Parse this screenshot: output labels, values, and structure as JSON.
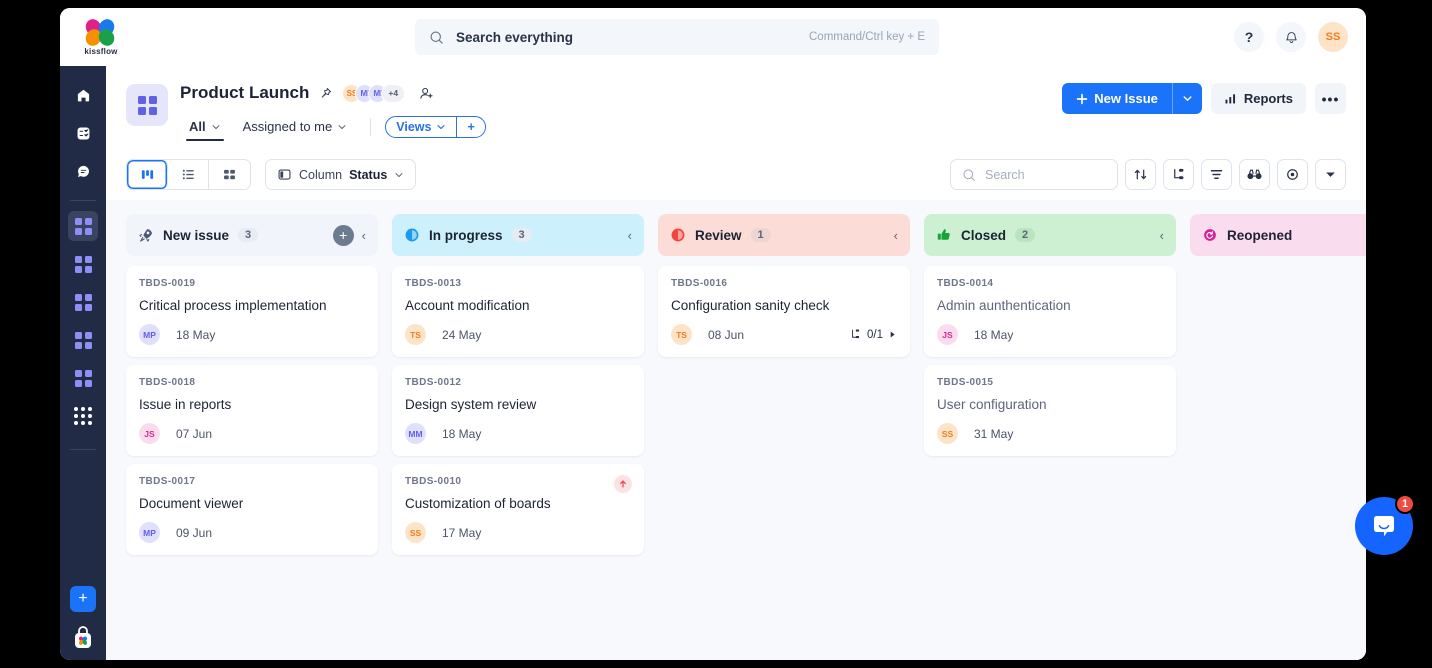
{
  "brand": {
    "name": "kissflow"
  },
  "search": {
    "placeholder": "Search everything",
    "hint": "Command/Ctrl key + E"
  },
  "topbar": {
    "help_label": "?",
    "avatar_initials": "SS"
  },
  "project": {
    "title": "Product Launch",
    "members": [
      {
        "initials": "SS",
        "bg": "#fde3c8",
        "color": "#f07d1a"
      },
      {
        "initials": "MI",
        "bg": "#e0e0fb",
        "color": "#6161e8"
      },
      {
        "initials": "MI",
        "bg": "#e0e0fb",
        "color": "#6161e8"
      }
    ],
    "members_more": "+4",
    "tabs": [
      {
        "label": "All",
        "active": true
      },
      {
        "label": "Assigned to me",
        "active": false
      }
    ],
    "views_label": "Views",
    "views_add_label": "+"
  },
  "actions": {
    "new_issue_label": "New Issue",
    "reports_label": "Reports",
    "more_label": "•••"
  },
  "toolbar": {
    "views": [
      "board-view",
      "list-view",
      "grid-view"
    ],
    "column_label": "Column",
    "column_value": "Status",
    "search_placeholder": "Search",
    "icons": [
      "sort-icon",
      "group-icon",
      "filter-icon",
      "watch-icon",
      "visibility-icon",
      "chevron-down-icon"
    ]
  },
  "board": {
    "columns": [
      {
        "name": "New issue",
        "count": "3",
        "icon": "rocket-icon",
        "header_bg": "#f1f4fa",
        "has_add": true,
        "cards": [
          {
            "id": "TBDS-0019",
            "title": "Critical process implementation",
            "avatar": "MP",
            "av_bg": "#e0e0fb",
            "av_color": "#6161e8",
            "date": "18 May",
            "subtasks": "",
            "priority": false
          },
          {
            "id": "TBDS-0018",
            "title": "Issue in reports",
            "avatar": "JS",
            "av_bg": "#fbdcee",
            "av_color": "#d6288f",
            "date": "07 Jun",
            "subtasks": "",
            "priority": false
          },
          {
            "id": "TBDS-0017",
            "title": "Document viewer",
            "avatar": "MP",
            "av_bg": "#e0e0fb",
            "av_color": "#6161e8",
            "date": "09 Jun",
            "subtasks": "",
            "priority": false
          }
        ]
      },
      {
        "name": "In progress",
        "count": "3",
        "icon": "progress-icon",
        "header_bg": "#cdf0fd",
        "has_add": false,
        "cards": [
          {
            "id": "TBDS-0013",
            "title": "Account modification",
            "avatar": "TS",
            "av_bg": "#fde3c8",
            "av_color": "#f07d1a",
            "date": "24 May",
            "subtasks": "",
            "priority": false
          },
          {
            "id": "TBDS-0012",
            "title": "Design system review",
            "avatar": "MM",
            "av_bg": "#e0e0fb",
            "av_color": "#6161e8",
            "date": "18 May",
            "subtasks": "",
            "priority": false
          },
          {
            "id": "TBDS-0010",
            "title": "Customization of boards",
            "avatar": "SS",
            "av_bg": "#fde3c8",
            "av_color": "#f07d1a",
            "date": "17 May",
            "subtasks": "",
            "priority": true
          }
        ]
      },
      {
        "name": "Review",
        "count": "1",
        "icon": "review-icon",
        "header_bg": "#fcdcd6",
        "has_add": false,
        "cards": [
          {
            "id": "TBDS-0016",
            "title": "Configuration sanity check",
            "avatar": "TS",
            "av_bg": "#fde3c8",
            "av_color": "#f07d1a",
            "date": "08 Jun",
            "subtasks": "0/1",
            "priority": false
          }
        ]
      },
      {
        "name": "Closed",
        "count": "2",
        "icon": "thumbs-up-icon",
        "header_bg": "#cdf0d2",
        "has_add": false,
        "cards": [
          {
            "id": "TBDS-0014",
            "title": "Admin aunthentication",
            "avatar": "JS",
            "av_bg": "#fbdcee",
            "av_color": "#d6288f",
            "date": "18 May",
            "subtasks": "",
            "priority": false
          },
          {
            "id": "TBDS-0015",
            "title": "User configuration",
            "avatar": "SS",
            "av_bg": "#fde3c8",
            "av_color": "#f07d1a",
            "date": "31 May",
            "subtasks": "",
            "priority": false
          }
        ]
      },
      {
        "name": "Reopened",
        "count": "",
        "icon": "reopen-icon",
        "header_bg": "#fadcef",
        "has_add": false,
        "cards": []
      }
    ]
  },
  "sidebar": {
    "items": [
      {
        "name": "home-icon"
      },
      {
        "name": "tasks-icon"
      },
      {
        "name": "chat-icon"
      },
      {
        "name": "board-app-1",
        "active": true
      },
      {
        "name": "board-app-2",
        "active": false
      },
      {
        "name": "board-app-3",
        "active": false
      },
      {
        "name": "board-app-4",
        "active": false
      },
      {
        "name": "board-app-5",
        "active": false
      },
      {
        "name": "apps-grid-icon",
        "active": false
      }
    ],
    "add_label": "+"
  },
  "intercom": {
    "badge": "1"
  },
  "colors": {
    "primary": "#1a73f8",
    "accent_purple": "#6161e8",
    "sidebar": "#222b45"
  }
}
